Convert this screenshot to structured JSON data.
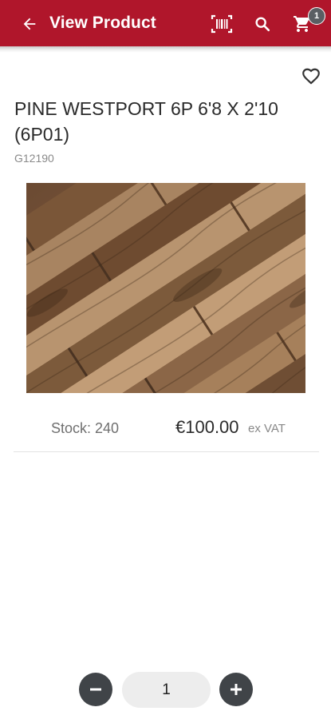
{
  "appbar": {
    "title": "View Product",
    "color": "#b0162b",
    "icons": [
      "back-arrow-icon",
      "barcode-icon",
      "search-icon",
      "cart-icon"
    ],
    "cart_count": "1"
  },
  "product": {
    "title": "PINE WESTPORT 6P 6'8 X 2'10 (6P01)",
    "code": "G12190",
    "image": "wood-plank-flooring-image",
    "stock_label": "Stock: 240",
    "price": "€100.00",
    "vat_label": "ex VAT",
    "favorite_icon": "heart-outline-icon"
  },
  "quantity": {
    "value": "1",
    "minus_icon": "minus-icon",
    "plus_icon": "plus-icon"
  }
}
